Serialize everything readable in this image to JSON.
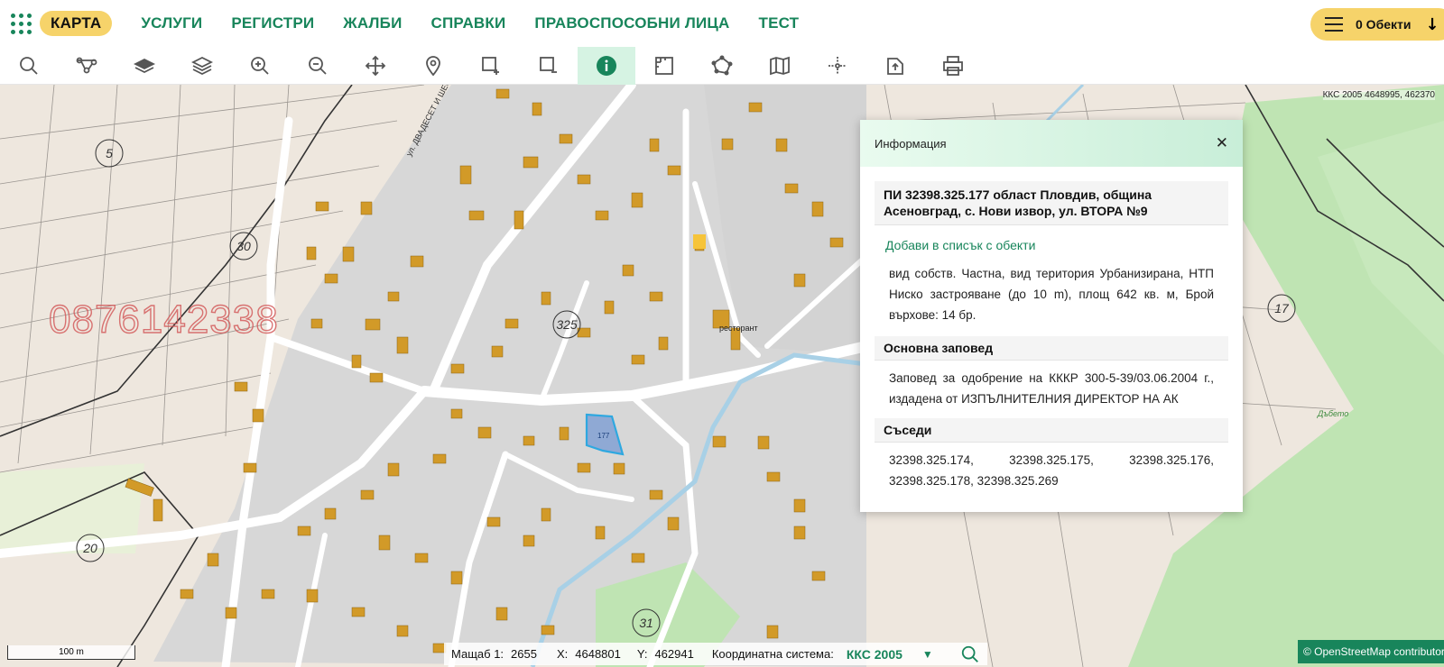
{
  "nav": {
    "items": [
      {
        "label": "КАРТА",
        "active": true
      },
      {
        "label": "УСЛУГИ"
      },
      {
        "label": "РЕГИСТРИ"
      },
      {
        "label": "ЖАЛБИ"
      },
      {
        "label": "СПРАВКИ"
      },
      {
        "label": "ПРАВОСПОСОБНИ ЛИЦА"
      },
      {
        "label": "ТЕСТ"
      }
    ],
    "objects_label": "0 Обекти"
  },
  "toolbar": {
    "tools": [
      "search-icon",
      "route-icon",
      "layer-icon",
      "layers-icon",
      "zoom-in-icon",
      "zoom-out-icon",
      "pan-icon",
      "location-pin-icon",
      "select-add-icon",
      "select-remove-icon",
      "info-icon",
      "measure-icon",
      "polygon-icon",
      "map-book-icon",
      "crosshair-icon",
      "export-icon",
      "print-icon"
    ],
    "active_tool": "info-icon"
  },
  "map": {
    "top_coord_readout": "ККС 2005 4648995, 462370",
    "phone_watermark": "0876142338",
    "labels": {
      "label_5": "5",
      "label_30": "30",
      "label_20": "20",
      "label_17": "17",
      "label_31": "31",
      "label_325": "325",
      "restaurant": "ресторант",
      "dubeto": "Дъбето",
      "street_n": "ул. ДВАДЕСЕТ И ШЕСТА"
    },
    "highlighted_parcel": "177"
  },
  "info_panel": {
    "title": "Информация",
    "parcel_title": "ПИ 32398.325.177 област Пловдив, община Асеновград, с. Нови извор, ул. ВТОРА №9",
    "add_link": "Добави в списък с обекти",
    "description": "вид собств. Частна, вид територия Урбанизирана, НТП Ниско застрояване (до 10 m), площ 642 кв. м, Брой върхове: 14 бр.",
    "order_header": "Основна заповед",
    "order_text": "Заповед за одобрение на КККР 300-5-39/03.06.2004 г., издадена от ИЗПЪЛНИТЕЛНИЯ ДИРЕКТОР НА АК",
    "neighbors_header": "Съседи",
    "neighbors_text": "32398.325.174, 32398.325.175, 32398.325.176, 32398.325.178, 32398.325.269"
  },
  "status_bar": {
    "scale_label": "Мащаб 1:",
    "scale_value": "2655",
    "x_label": "X:",
    "x_value": "4648801",
    "y_label": "Y:",
    "y_value": "462941",
    "coord_system_label": "Координатна система:",
    "coord_system_value": "ККС 2005"
  },
  "scale_bar": "100 m",
  "attribution": "© OpenStreetMap contributors",
  "colors": {
    "accent": "#18855b",
    "active_nav": "#f6d36a",
    "building": "#d29a28",
    "parcel_fill": "#d6d6d6",
    "highlight": "#2ea8e0",
    "green_area": "#bfe4b3",
    "watermark": "#d45d5d"
  }
}
